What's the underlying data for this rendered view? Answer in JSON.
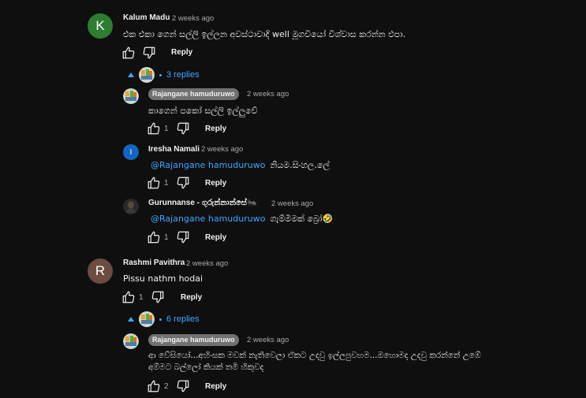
{
  "colors": {
    "background": "#0f0f0f",
    "link": "#3ea6ff",
    "avatar_k": "#2e7d32",
    "avatar_i": "#1565c0",
    "avatar_r": "#6d4c41"
  },
  "comments": [
    {
      "avatar_letter": "K",
      "author": "Kalum Madu",
      "time": "2 weeks ago",
      "text": "එක එකා ගෙන් සල්ලි ඉල්ලන අවස්ථාවාදී  well මූගවියෝ විශ්වාස කරන්න එපා.",
      "likes": "",
      "reply_label": "Reply",
      "replies_label": "3 replies"
    },
    {
      "avatar_letter": "R",
      "author": "Rashmi Pavithra",
      "time": "2 weeks ago",
      "text": "Pissu nathm hodai",
      "likes": "1",
      "reply_label": "Reply",
      "replies_label": "6 replies"
    }
  ],
  "replies": [
    {
      "author": "Rajangane hamuduruwo",
      "time": "2 weeks ago",
      "text": "කාගෙන් පකෝ සල්ලි ඉල්ලුවේ",
      "likes": "1",
      "reply_label": "Reply"
    },
    {
      "avatar_letter": "I",
      "author": "Iresha Namali",
      "time": "2 weeks ago",
      "mention": "@Rajangane hamuduruwo",
      "text": "නියම.සිංහල.ලේ",
      "likes": "1",
      "reply_label": "Reply"
    },
    {
      "author": "Gurunnanse - ගුරුන්නාන්සේ🐜",
      "time": "2 weeks ago",
      "mention": "@Rajangane hamuduruwo",
      "text": "ගැම්මිමක් බ්‍රෝ🤣",
      "likes": "1",
      "reply_label": "Reply"
    },
    {
      "author": "Rajangane hamuduruwo",
      "time": "2 weeks ago",
      "text_line1": "ආ වේසියෝ...අහිංසක මවක් නැතිවෙලා ඒකට උදවු ඉල්ලපුවහම...ඔහොමද උදවු කරන්නේ උඹේ",
      "text_line2": "අම්මට බල්ලෝ කියක් තමි හිකුවද",
      "likes": "2",
      "reply_label": "Reply"
    }
  ],
  "icons": {
    "like": "thumb-up-icon",
    "dislike": "thumb-down-icon",
    "collapse": "caret-up-icon"
  }
}
